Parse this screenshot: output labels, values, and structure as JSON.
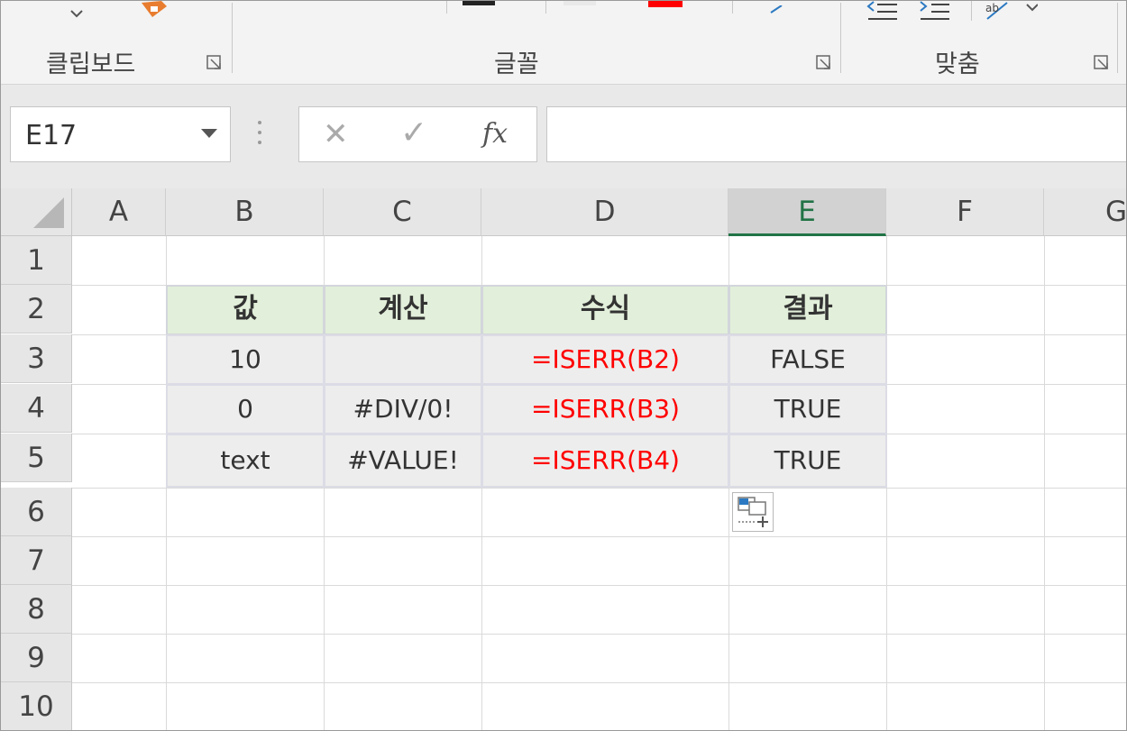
{
  "ribbon": {
    "groups": [
      {
        "label": "클립보드"
      },
      {
        "label": "글꼴"
      },
      {
        "label": "맞춤"
      }
    ]
  },
  "formula_bar": {
    "name_box": "E17",
    "cancel_icon": "✕",
    "enter_icon": "✓",
    "fx_label": "fx",
    "formula": ""
  },
  "sheet": {
    "columns": [
      "A",
      "B",
      "C",
      "D",
      "E",
      "F",
      "G"
    ],
    "selected_column": "E",
    "rows": [
      "1",
      "2",
      "3",
      "4",
      "5",
      "6",
      "7",
      "8",
      "9",
      "10"
    ],
    "table": {
      "headers": [
        "값",
        "계산",
        "수식",
        "결과"
      ],
      "rows": [
        [
          "10",
          "",
          "=ISERR(B2)",
          "FALSE"
        ],
        [
          "0",
          "#DIV/0!",
          "=ISERR(B3)",
          "TRUE"
        ],
        [
          "text",
          "#VALUE!",
          "=ISERR(B4)",
          "TRUE"
        ]
      ]
    }
  },
  "colors": {
    "header_fill": "#e2efda",
    "body_fill": "#ededed",
    "formula_text": "#ff0000",
    "selected_column_accent": "#217346"
  },
  "icons": [
    "paste-icon",
    "dropdown-caret-icon",
    "launcher-icon",
    "cancel-icon",
    "enter-icon",
    "fx-icon",
    "select-all-icon",
    "paste-options-icon",
    "align-icon",
    "orientation-icon"
  ]
}
